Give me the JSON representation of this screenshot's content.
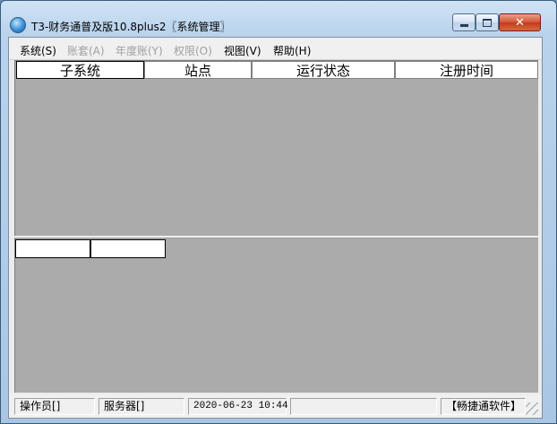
{
  "window": {
    "title": "T3-财务通普及版10.8plus2〖系统管理〗",
    "close_glyph": "✕"
  },
  "menu": {
    "items": [
      {
        "label": "系统(S)",
        "enabled": true
      },
      {
        "label": "账套(A)",
        "enabled": false
      },
      {
        "label": "年度账(Y)",
        "enabled": false
      },
      {
        "label": "权限(O)",
        "enabled": false
      },
      {
        "label": "视图(V)",
        "enabled": true
      },
      {
        "label": "帮助(H)",
        "enabled": true
      }
    ]
  },
  "upper_table": {
    "columns": [
      "子系统",
      "站点",
      "运行状态",
      "注册时间"
    ]
  },
  "status_bar": {
    "operator": "操作员[]",
    "server": "服务器[]",
    "datetime": "2020-06-23 10:44",
    "brand": "【畅捷通软件】"
  },
  "colors": {
    "pane_background": "#ababab",
    "close_button": "#c13b1c"
  }
}
